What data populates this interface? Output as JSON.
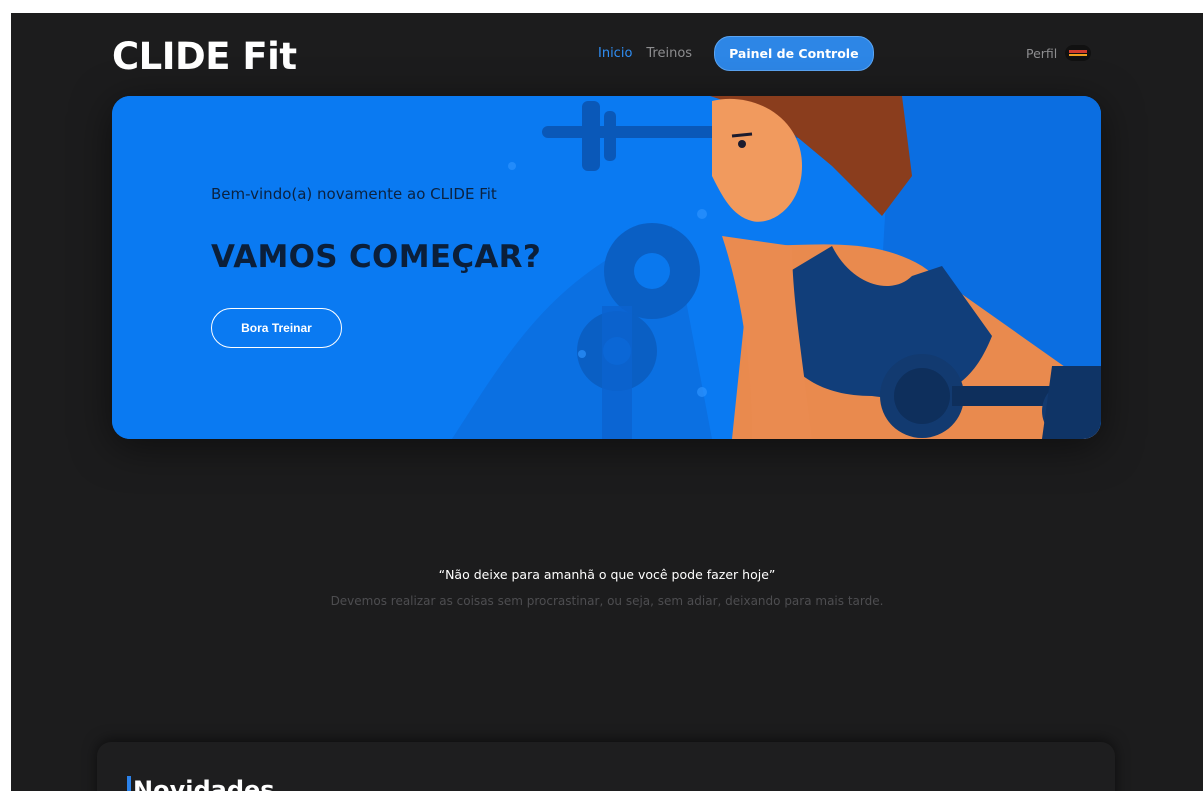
{
  "header": {
    "logo": "CLIDE Fit",
    "nav": [
      {
        "label": "Inicio"
      },
      {
        "label": "Treinos"
      },
      {
        "label": "Painel de Controle"
      }
    ],
    "profile_label": "Perfil"
  },
  "hero": {
    "subtitle": "Bem-vindo(a) novamente ao CLIDE Fit",
    "title": "VAMOS COMEÇAR?",
    "button_label": "Bora Treinar"
  },
  "quote": {
    "text": "“Não deixe para amanhã o que você pode fazer hoje”",
    "subtext": "Devemos realizar as coisas sem procrastinar, ou seja, sem adiar, deixando para mais tarde."
  },
  "news": {
    "title": "Novidades"
  },
  "colors": {
    "background": "#1c1c1d",
    "accent": "#2d86e6",
    "hero": "#0a7af2"
  }
}
